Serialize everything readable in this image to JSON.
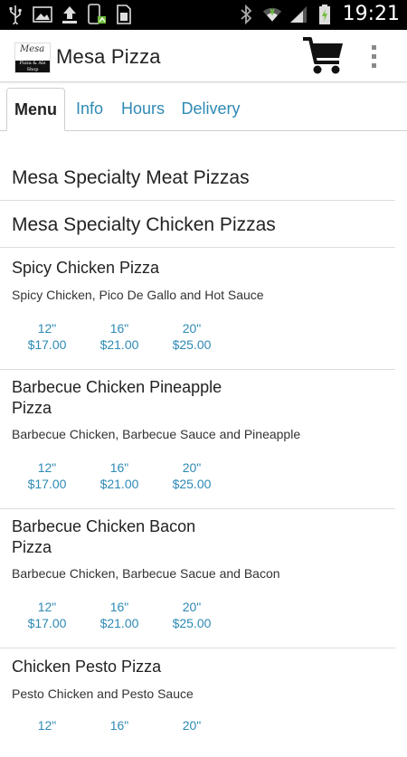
{
  "status_bar": {
    "time": "19:21",
    "icons_left": [
      "usb-icon",
      "image-icon",
      "upload-icon",
      "phone-sync-icon",
      "sim-icon"
    ],
    "icons_right": [
      "bluetooth-icon",
      "wifi-icon",
      "signal-icon",
      "battery-charging-icon"
    ]
  },
  "app_bar": {
    "logo_text": "Mesa",
    "logo_subtext": "Pizza & Ale Shop",
    "title": "Mesa Pizza",
    "cart_icon": "cart-icon",
    "menu_icon": "overflow-menu-icon"
  },
  "tabs": [
    {
      "label": "Menu",
      "active": true
    },
    {
      "label": "Info",
      "active": false
    },
    {
      "label": "Hours",
      "active": false
    },
    {
      "label": "Delivery",
      "active": false
    }
  ],
  "categories": [
    {
      "title": "Mesa Specialty Meat Pizzas"
    },
    {
      "title": "Mesa Specialty Chicken Pizzas"
    }
  ],
  "items": [
    {
      "name": "Spicy Chicken Pizza",
      "description": "Spicy Chicken, Pico De Gallo and Hot Sauce",
      "prices": [
        {
          "size": "12\"",
          "price": "$17.00"
        },
        {
          "size": "16\"",
          "price": "$21.00"
        },
        {
          "size": "20\"",
          "price": "$25.00"
        }
      ]
    },
    {
      "name": "Barbecue Chicken Pineapple Pizza",
      "description": "Barbecue Chicken, Barbecue Sauce and Pineapple",
      "prices": [
        {
          "size": "12\"",
          "price": "$17.00"
        },
        {
          "size": "16\"",
          "price": "$21.00"
        },
        {
          "size": "20\"",
          "price": "$25.00"
        }
      ]
    },
    {
      "name": "Barbecue Chicken Bacon Pizza",
      "description": "Barbecue Chicken, Barbecue Sacue and Bacon",
      "prices": [
        {
          "size": "12\"",
          "price": "$17.00"
        },
        {
          "size": "16\"",
          "price": "$21.00"
        },
        {
          "size": "20\"",
          "price": "$25.00"
        }
      ]
    },
    {
      "name": "Chicken Pesto Pizza",
      "description": "Pesto Chicken and Pesto Sauce",
      "prices": [
        {
          "size": "12\"",
          "price": ""
        },
        {
          "size": "16\"",
          "price": ""
        },
        {
          "size": "20\"",
          "price": ""
        }
      ]
    }
  ],
  "colors": {
    "accent": "#2e8ab5",
    "status_bar": "#000000",
    "divider": "#dddddd"
  }
}
